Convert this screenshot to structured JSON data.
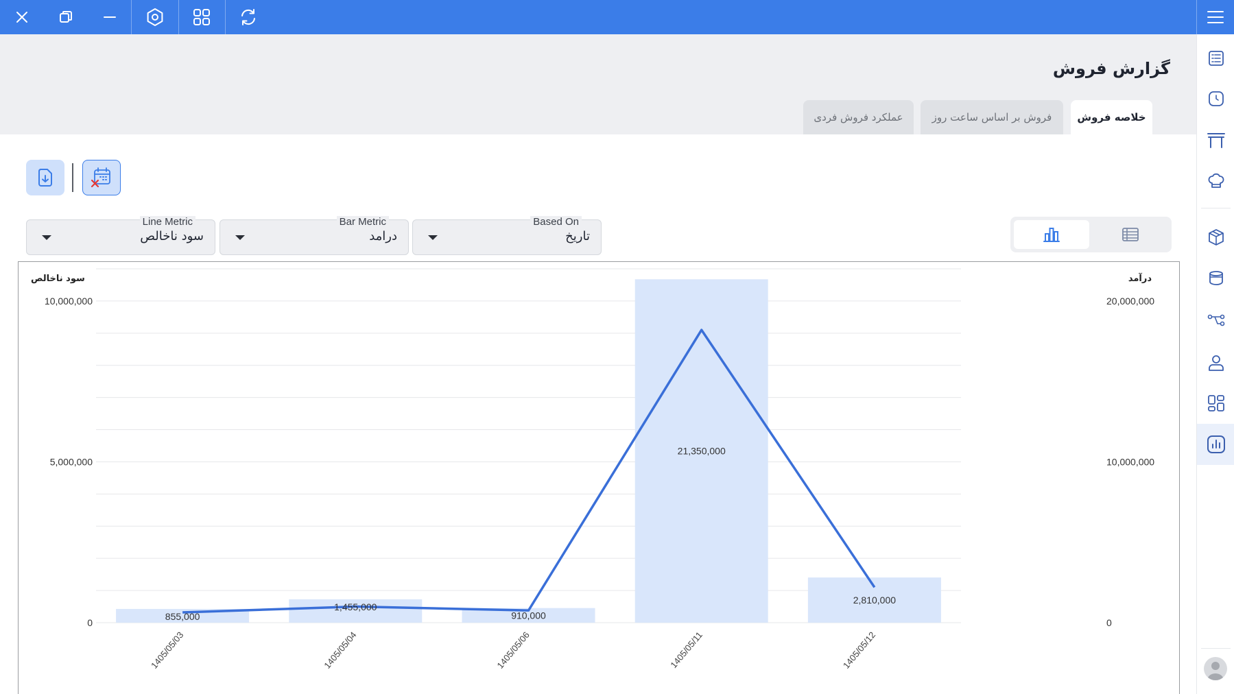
{
  "topbar": {
    "buttons": [
      {
        "name": "close-icon"
      },
      {
        "name": "restore-window-icon"
      },
      {
        "name": "minimize-icon"
      },
      {
        "name": "settings-hexagon-icon"
      },
      {
        "name": "apps-grid-icon"
      },
      {
        "name": "refresh-icon"
      },
      {
        "name": "menu-icon"
      }
    ]
  },
  "page": {
    "title": "گزارش فروش"
  },
  "tabs": [
    {
      "label": "خلاصه فروش",
      "active": true
    },
    {
      "label": "فروش بر اساس ساعت روز",
      "active": false
    },
    {
      "label": "عملکرد فروش فردی",
      "active": false
    }
  ],
  "filters": {
    "based_on": {
      "label": "Based On",
      "value": "تاریخ"
    },
    "bar_metric": {
      "label": "Bar Metric",
      "value": "درامد"
    },
    "line_metric": {
      "label": "Line Metric",
      "value": "سود ناخالص"
    }
  },
  "sidebar": {
    "items": [
      {
        "name": "receipt-list-icon"
      },
      {
        "name": "clock-icon"
      },
      {
        "name": "table-icon"
      },
      {
        "name": "chef-hat-icon"
      },
      {
        "name": "package-box-icon"
      },
      {
        "name": "pot-icon"
      },
      {
        "name": "workflow-icon"
      },
      {
        "name": "user-icon"
      },
      {
        "name": "dashboard-grid-icon"
      },
      {
        "name": "report-chart-icon",
        "active": true
      }
    ]
  },
  "colors": {
    "accent": "#3b7de8",
    "bar_fill": "#d9e6fb",
    "line": "#3a6fd8"
  },
  "chart_data": {
    "type": "bar",
    "categories": [
      "1405/05/03",
      "1405/05/04",
      "1405/05/06",
      "1405/05/11",
      "1405/05/12"
    ],
    "bar_series": {
      "values": [
        855000,
        1455000,
        910000,
        21350000,
        2810000
      ],
      "value_labels": [
        "855,000",
        "1,455,000",
        "910,000",
        "21,350,000",
        "2,810,000"
      ]
    },
    "line_series": {
      "values": [
        320000,
        500000,
        380000,
        9100000,
        1100000
      ]
    },
    "left_axis": {
      "label": "سود ناخالص",
      "ylim": [
        0,
        11000000
      ],
      "ticks": [
        0,
        5000000,
        10000000
      ],
      "tick_labels": [
        "0",
        "5,000,000",
        "10,000,000"
      ]
    },
    "right_axis": {
      "label": "درآمد",
      "ylim": [
        0,
        22000000
      ],
      "ticks": [
        0,
        10000000,
        20000000
      ],
      "tick_labels": [
        "0",
        "10,000,000",
        "20,000,000"
      ]
    },
    "grid": true
  }
}
